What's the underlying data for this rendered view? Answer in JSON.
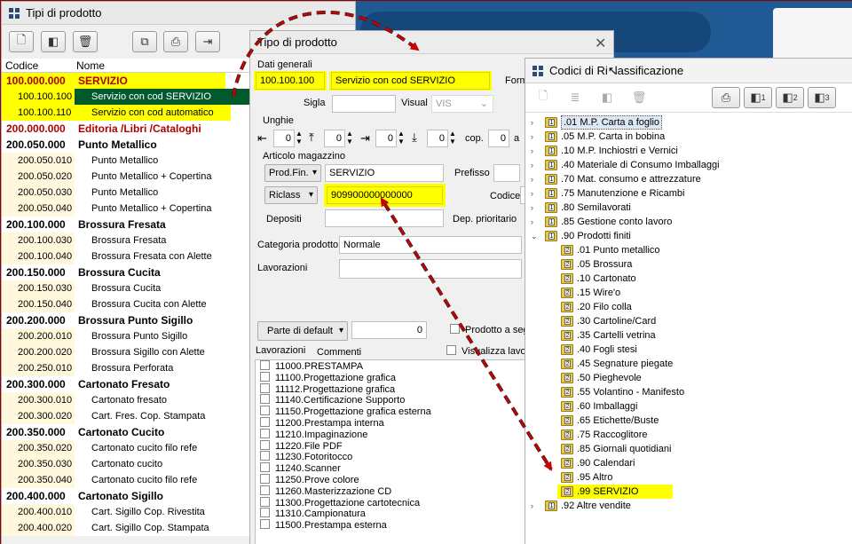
{
  "window1": {
    "title": "Tipi di prodotto",
    "columns": {
      "code": "Codice",
      "name": "Nome"
    },
    "rows": [
      {
        "code": "100.000.000",
        "name": "SERVIZIO",
        "level": 0,
        "style": "red"
      },
      {
        "code": "100.100.100",
        "name": "Servizio con cod SERVIZIO",
        "level": 1,
        "style": "sel"
      },
      {
        "code": "100.100.110",
        "name": "Servizio con cod automatico",
        "level": 1,
        "style": "hl"
      },
      {
        "code": "200.000.000",
        "name": "Editoria /Libri /Cataloghi",
        "level": 0,
        "style": "red"
      },
      {
        "code": "200.050.000",
        "name": "Punto Metallico",
        "level": 0,
        "style": ""
      },
      {
        "code": "200.050.010",
        "name": "Punto Metallico",
        "level": 1,
        "style": ""
      },
      {
        "code": "200.050.020",
        "name": "Punto Metallico + Copertina",
        "level": 1,
        "style": ""
      },
      {
        "code": "200.050.030",
        "name": "Punto Metallico",
        "level": 1,
        "style": ""
      },
      {
        "code": "200.050.040",
        "name": "Punto Metallico + Copertina",
        "level": 1,
        "style": ""
      },
      {
        "code": "200.100.000",
        "name": "Brossura Fresata",
        "level": 0,
        "style": ""
      },
      {
        "code": "200.100.030",
        "name": "Brossura Fresata",
        "level": 1,
        "style": ""
      },
      {
        "code": "200.100.040",
        "name": "Brossura Fresata con Alette",
        "level": 1,
        "style": ""
      },
      {
        "code": "200.150.000",
        "name": "Brossura Cucita",
        "level": 0,
        "style": ""
      },
      {
        "code": "200.150.030",
        "name": "Brossura Cucita",
        "level": 1,
        "style": ""
      },
      {
        "code": "200.150.040",
        "name": "Brossura Cucita con Alette",
        "level": 1,
        "style": ""
      },
      {
        "code": "200.200.000",
        "name": "Brossura Punto Sigillo",
        "level": 0,
        "style": ""
      },
      {
        "code": "200.200.010",
        "name": "Brossura Punto Sigillo",
        "level": 1,
        "style": ""
      },
      {
        "code": "200.200.020",
        "name": "Brossura Sigillo con Alette",
        "level": 1,
        "style": ""
      },
      {
        "code": "200.250.010",
        "name": "Brossura Perforata",
        "level": 1,
        "style": ""
      },
      {
        "code": "200.300.000",
        "name": "Cartonato Fresato",
        "level": 0,
        "style": ""
      },
      {
        "code": "200.300.010",
        "name": "Cartonato fresato",
        "level": 1,
        "style": ""
      },
      {
        "code": "200.300.020",
        "name": "Cart. Fres. Cop. Stampata",
        "level": 1,
        "style": ""
      },
      {
        "code": "200.350.000",
        "name": "Cartonato Cucito",
        "level": 0,
        "style": ""
      },
      {
        "code": "200.350.020",
        "name": "Cartonato cucito filo refe",
        "level": 1,
        "style": ""
      },
      {
        "code": "200.350.030",
        "name": "Cartonato cucito",
        "level": 1,
        "style": ""
      },
      {
        "code": "200.350.040",
        "name": "Cartonato cucito filo refe",
        "level": 1,
        "style": ""
      },
      {
        "code": "200.400.000",
        "name": "Cartonato Sigillo",
        "level": 0,
        "style": ""
      },
      {
        "code": "200.400.010",
        "name": "Cart. Sigillo Cop. Rivestita",
        "level": 1,
        "style": ""
      },
      {
        "code": "200.400.020",
        "name": "Cart. Sigillo Cop. Stampata",
        "level": 1,
        "style": ""
      }
    ]
  },
  "window2": {
    "title": "Tipo di prodotto",
    "dati_generali": "Dati generali",
    "code": "100.100.100",
    "name": "Servizio con cod SERVIZIO",
    "form_label": "Form",
    "sigla": "Sigla",
    "visual": "Visual",
    "visual_value": "VIS",
    "unghie": "Unghie",
    "unghie_values": [
      "0",
      "0",
      "0",
      "0"
    ],
    "cop": "cop.",
    "cop_value": "0",
    "a": "a",
    "articolo_magazzino": "Articolo magazzino",
    "prod_fin": "Prod.Fin.",
    "prod_fin_value": "SERVIZIO",
    "prefisso": "Prefisso",
    "riclass": "Riclass",
    "riclass_value": "909900000000000",
    "codice": "Codice",
    "depositi": "Depositi",
    "dep_prioritario": "Dep. prioritario",
    "categoria_prodotto": "Categoria prodotto",
    "categoria_value": "Normale",
    "lavorazioni": "Lavorazioni",
    "parte_default": "Parte di default",
    "parte_value": "0",
    "prodotto_a_seg": "Prodotto a seg",
    "visualizza_lavo": "Visualizza lavo",
    "tab_lavorazioni": "Lavorazioni",
    "tab_commenti": "Commenti",
    "lav_items": [
      "11000.PRESTAMPA",
      "11100.Progettazione grafica",
      "11112.Progettazione grafica",
      "11140.Certificazione Supporto",
      "11150.Progettazione grafica esterna",
      "11200.Prestampa interna",
      "11210.Impaginazione",
      "11220.File PDF",
      "11230.Fotoritocco",
      "11240.Scanner",
      "11250.Prove colore",
      "11260.Masterizzazione CD",
      "11300.Progettazione cartotecnica",
      "11310.Campionatura",
      "11500.Prestampa esterna"
    ]
  },
  "window3": {
    "title": "Codici di Riclassificazione",
    "title_visible": "Codici di Ri",
    "title_tail": "lassificazione",
    "nodes": [
      {
        "label": ".01 M.P. Carta a foglio",
        "level": 0,
        "exp": "›",
        "num": "1",
        "hl": "box"
      },
      {
        "label": ".05 M.P. Carta in bobina",
        "level": 0,
        "exp": "›",
        "num": "1",
        "hl": ""
      },
      {
        "label": ".10 M.P. Inchiostri e Vernici",
        "level": 0,
        "exp": "›",
        "num": "1",
        "hl": ""
      },
      {
        "label": ".40 Materiale di Consumo Imballaggi",
        "level": 0,
        "exp": "›",
        "num": "1",
        "hl": ""
      },
      {
        "label": ".70 Mat. consumo e attrezzature",
        "level": 0,
        "exp": "›",
        "num": "1",
        "hl": ""
      },
      {
        "label": ".75 Manutenzione e Ricambi",
        "level": 0,
        "exp": "›",
        "num": "1",
        "hl": ""
      },
      {
        "label": ".80 Semilavorati",
        "level": 0,
        "exp": "›",
        "num": "1",
        "hl": ""
      },
      {
        "label": ".85 Gestione conto lavoro",
        "level": 0,
        "exp": "›",
        "num": "1",
        "hl": ""
      },
      {
        "label": ".90 Prodotti finiti",
        "level": 0,
        "exp": "⌄",
        "num": "1",
        "hl": ""
      },
      {
        "label": ".01 Punto metallico",
        "level": 1,
        "exp": "",
        "num": "2",
        "hl": ""
      },
      {
        "label": ".05 Brossura",
        "level": 1,
        "exp": "",
        "num": "2",
        "hl": ""
      },
      {
        "label": ".10 Cartonato",
        "level": 1,
        "exp": "",
        "num": "2",
        "hl": ""
      },
      {
        "label": ".15 Wire'o",
        "level": 1,
        "exp": "",
        "num": "2",
        "hl": ""
      },
      {
        "label": ".20 Filo colla",
        "level": 1,
        "exp": "",
        "num": "2",
        "hl": ""
      },
      {
        "label": ".30 Cartoline/Card",
        "level": 1,
        "exp": "",
        "num": "2",
        "hl": ""
      },
      {
        "label": ".35 Cartelli vetrina",
        "level": 1,
        "exp": "",
        "num": "2",
        "hl": ""
      },
      {
        "label": ".40 Fogli stesi",
        "level": 1,
        "exp": "",
        "num": "2",
        "hl": ""
      },
      {
        "label": ".45 Segnature piegate",
        "level": 1,
        "exp": "",
        "num": "2",
        "hl": ""
      },
      {
        "label": ".50 Pieghevole",
        "level": 1,
        "exp": "",
        "num": "2",
        "hl": ""
      },
      {
        "label": ".55 Volantino - Manifesto",
        "level": 1,
        "exp": "",
        "num": "2",
        "hl": ""
      },
      {
        "label": ".60 Imballaggi",
        "level": 1,
        "exp": "",
        "num": "2",
        "hl": ""
      },
      {
        "label": ".65 Etichette/Buste",
        "level": 1,
        "exp": "",
        "num": "2",
        "hl": ""
      },
      {
        "label": ".75 Raccoglitore",
        "level": 1,
        "exp": "",
        "num": "2",
        "hl": ""
      },
      {
        "label": ".85 Giornali quotidiani",
        "level": 1,
        "exp": "",
        "num": "2",
        "hl": ""
      },
      {
        "label": ".90 Calendari",
        "level": 1,
        "exp": "",
        "num": "2",
        "hl": ""
      },
      {
        "label": ".95 Altro",
        "level": 1,
        "exp": "",
        "num": "2",
        "hl": ""
      },
      {
        "label": ".99 SERVIZIO",
        "level": 1,
        "exp": "",
        "num": "2",
        "hl": "yellow"
      },
      {
        "label": ".92 Altre vendite",
        "level": 0,
        "exp": "›",
        "num": "1",
        "hl": ""
      }
    ],
    "toolbar_nums": [
      "1",
      "2",
      "3"
    ]
  },
  "colors": {
    "highlight": "#ffff00",
    "arrow": "#cc0000",
    "selection": "#005a2b",
    "red_text": "#b00000"
  }
}
